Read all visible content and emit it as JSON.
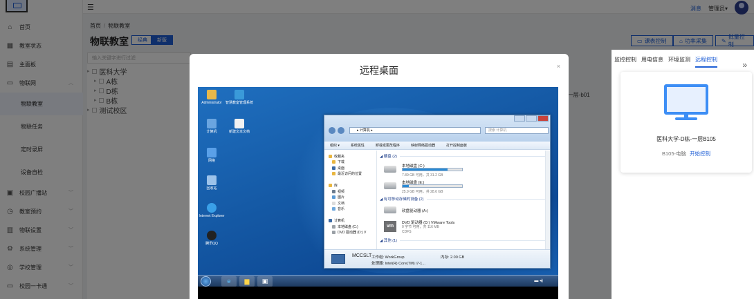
{
  "topbar": {
    "menu_icon": "hamburger-icon",
    "link": "消息",
    "admin": "管理员▾"
  },
  "sidebar": {
    "items": [
      {
        "label": "首页",
        "icon": "home-icon",
        "glyph": "⌂"
      },
      {
        "label": "教室状态",
        "icon": "building-icon",
        "glyph": "▦"
      },
      {
        "label": "主面板",
        "icon": "dashboard-icon",
        "glyph": "▤"
      },
      {
        "label": "物联网",
        "icon": "iot-icon",
        "glyph": "▭"
      }
    ],
    "sub_items": [
      "物联教室",
      "物联任务",
      "定时录屏",
      "设备自检"
    ],
    "items2": [
      {
        "label": "校园广播站",
        "icon": "broadcast-icon",
        "glyph": "▣"
      },
      {
        "label": "教室预约",
        "icon": "clock-icon",
        "glyph": "◷"
      },
      {
        "label": "物联设置",
        "icon": "settings-icon",
        "glyph": "▥"
      },
      {
        "label": "系统管理",
        "icon": "gear-icon",
        "glyph": "⚙"
      },
      {
        "label": "学校管理",
        "icon": "school-icon",
        "glyph": "◎"
      },
      {
        "label": "校园一卡通",
        "icon": "card-icon",
        "glyph": "▭"
      }
    ]
  },
  "main": {
    "breadcrumb": [
      "首页",
      "物联教室"
    ],
    "title": "物联教室",
    "view_toggle": [
      "经典",
      "新版"
    ],
    "actions": [
      "课表控制",
      "功率采集",
      "批量控制"
    ],
    "filter_placeholder": "输入关键字进行过滤",
    "tree": [
      {
        "label": "医科大学",
        "level": 0
      },
      {
        "label": "A栋",
        "level": 1
      },
      {
        "label": "D栋",
        "level": 1
      },
      {
        "label": "B栋",
        "level": 1
      },
      {
        "label": "测试校区",
        "level": 0
      }
    ],
    "bg_fragment": "-一层-b01"
  },
  "modal": {
    "title": "远程桌面",
    "close": "×",
    "desktop": {
      "icons": [
        {
          "label": "Administrator",
          "icon": "folder-icon",
          "color": "#e8b84a"
        },
        {
          "label": "智慧教室管理系统",
          "icon": "music-app-icon",
          "color": "#3a9ad9"
        },
        {
          "label": "计算机",
          "icon": "computer-icon",
          "color": "#6aa5e0"
        },
        {
          "label": "新建文本文档",
          "icon": "document-icon",
          "color": "#f2f2f2"
        },
        {
          "label": "网络",
          "icon": "network-icon",
          "color": "#5aa0e8"
        },
        {
          "label": "回收站",
          "icon": "recycle-bin-icon",
          "color": "#9dc3ea"
        },
        {
          "label": "Internet Explorer",
          "icon": "ie-icon",
          "color": "#3aa0e8"
        },
        {
          "label": "腾讯QQ",
          "icon": "qq-icon",
          "color": "#222222"
        }
      ],
      "explorer": {
        "address": "▸ 计算机 ▸",
        "search": "搜索 计算机",
        "commands": [
          "组织 ▾",
          "系统属性",
          "卸载或更改程序",
          "映射网络驱动器",
          "打开控制面板"
        ],
        "nav": [
          {
            "label": "收藏夹",
            "indent": false
          },
          {
            "label": "下载",
            "indent": true
          },
          {
            "label": "桌面",
            "indent": true
          },
          {
            "label": "最近访问的位置",
            "indent": true
          },
          {
            "label": "",
            "indent": false
          },
          {
            "label": "库",
            "indent": false
          },
          {
            "label": "视频",
            "indent": true
          },
          {
            "label": "图片",
            "indent": true
          },
          {
            "label": "文档",
            "indent": true
          },
          {
            "label": "音乐",
            "indent": true
          },
          {
            "label": "",
            "indent": false
          },
          {
            "label": "计算机",
            "indent": false
          },
          {
            "label": "本地磁盘 (C:)",
            "indent": true
          },
          {
            "label": "DVD 驱动器 (D:) V",
            "indent": true
          }
        ],
        "group_disks": "◢ 硬盘 (2)",
        "disks": [
          {
            "name": "本地磁盘 (C:)",
            "free": "7.89 GB 可用，共 31.2 GB",
            "used_fraction": 0.75
          },
          {
            "name": "本地磁盘 (E:)",
            "free": "25.9 GB 可用，共 28.6 GB",
            "used_fraction": 0.1
          }
        ],
        "group_removable": "◢ 有可移动存储的设备 (2)",
        "removable": [
          {
            "name": "软盘驱动器 (A:)",
            "detail": "",
            "detail2": ""
          },
          {
            "name": "DVD 驱动器 (D:) VMware Tools",
            "detail": "0 字节 可用，共 116 MB",
            "detail2": "CDFS"
          }
        ],
        "group_other": "◢ 其他 (1)",
        "status": {
          "name": "MCCSLT",
          "workgroup": "工作组: WorkGroup",
          "memory": "内存: 2.00 GB",
          "cpu": "处理器: Intel(R) Core(TM) i7-1..."
        }
      }
    }
  },
  "right_panel": {
    "tabs": [
      "监控控制",
      "用电信息",
      "环境监测",
      "远程控制"
    ],
    "active_tab": 3,
    "collapse": "»",
    "card": {
      "name": "医科大学-D栋-一层B105",
      "device": "B105-电脑",
      "action": "开始控制"
    }
  }
}
